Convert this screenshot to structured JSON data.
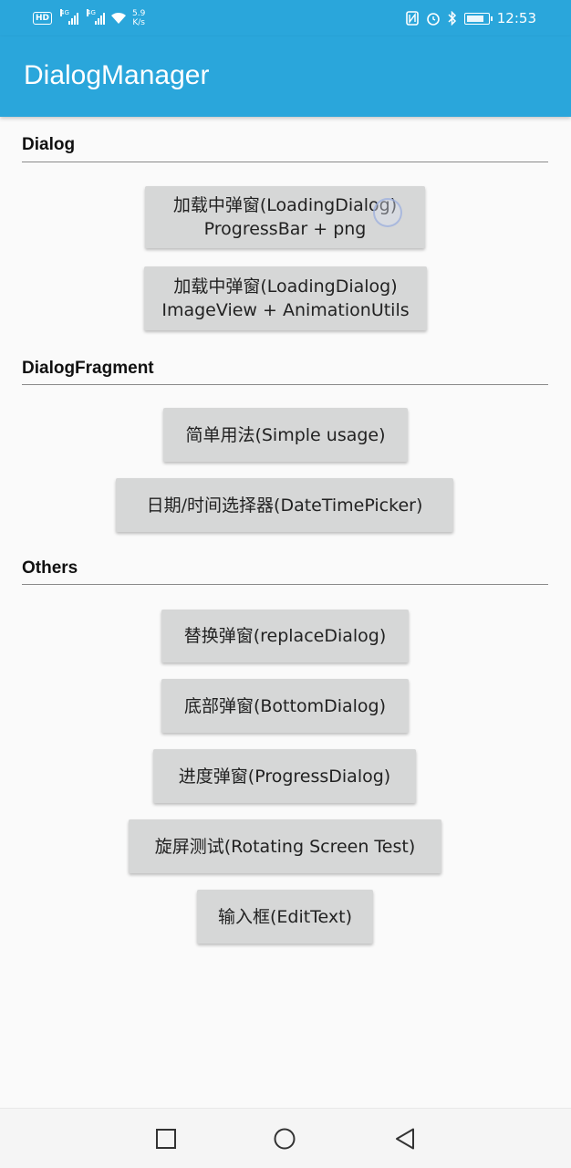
{
  "status_bar": {
    "hd": "HD",
    "net1": "4G",
    "net2": "4G",
    "speed_value": "5.9",
    "speed_unit": "K/s",
    "time": "12:53",
    "icons": [
      "nfc-icon",
      "alarm-icon",
      "bluetooth-icon",
      "battery-icon"
    ]
  },
  "app": {
    "title": "DialogManager"
  },
  "sections": {
    "dialog": {
      "title": "Dialog",
      "buttons": [
        {
          "line1": "加载中弹窗(LoadingDialog)",
          "line2": "ProgressBar + png"
        },
        {
          "line1": "加载中弹窗(LoadingDialog)",
          "line2": "ImageView + AnimationUtils"
        }
      ]
    },
    "fragment": {
      "title": "DialogFragment",
      "buttons": [
        {
          "label": "简单用法(Simple usage)"
        },
        {
          "label": "日期/时间选择器(DateTimePicker)"
        }
      ]
    },
    "others": {
      "title": "Others",
      "buttons": [
        {
          "label": "替换弹窗(replaceDialog)"
        },
        {
          "label": "底部弹窗(BottomDialog)"
        },
        {
          "label": "进度弹窗(ProgressDialog)"
        },
        {
          "label": "旋屏测试(Rotating Screen Test)"
        },
        {
          "label": "输入框(EditText)"
        }
      ]
    }
  },
  "nav_bar": {
    "icons": [
      "recents-icon",
      "home-icon",
      "back-icon"
    ]
  },
  "colors": {
    "primary": "#2aa6db",
    "button_bg": "#d6d7d7",
    "background": "#fafafa"
  }
}
